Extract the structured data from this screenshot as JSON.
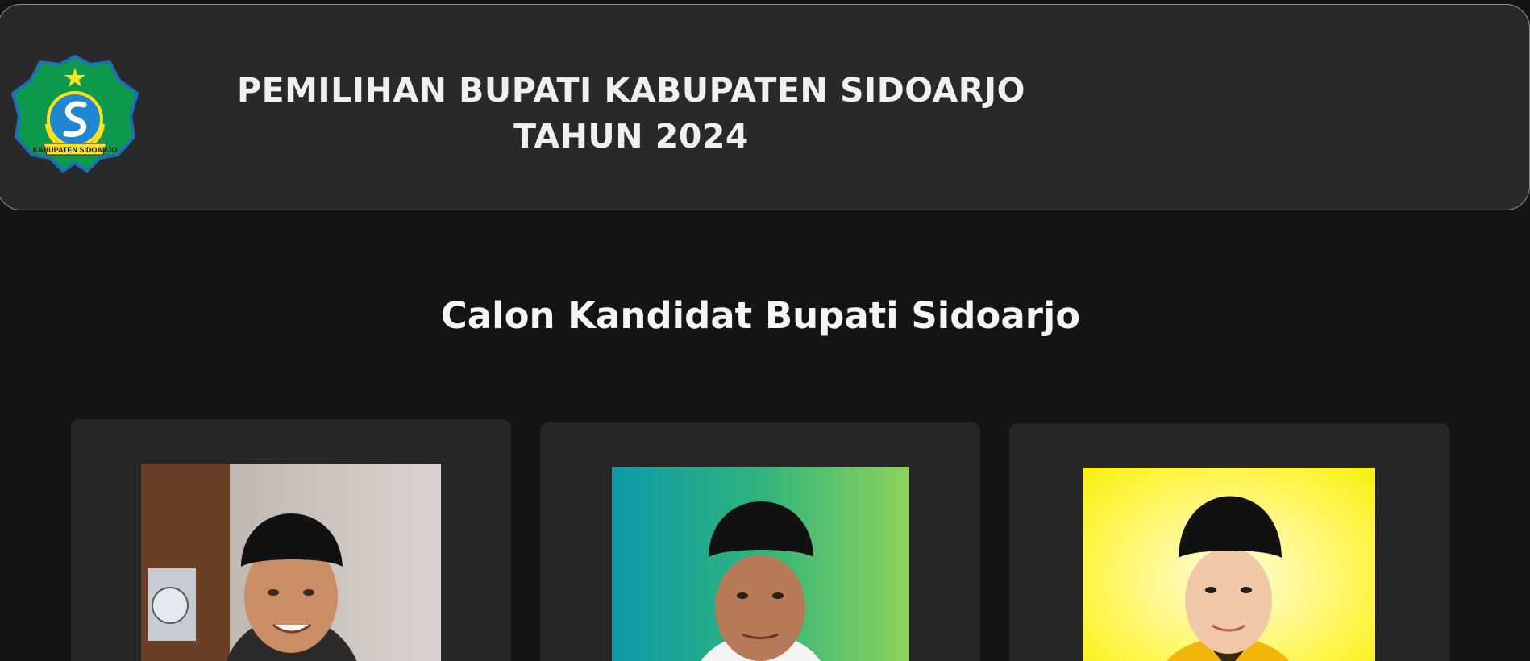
{
  "header": {
    "logo_label": "KABUPATEN SIDOARJO",
    "title_line1": "PEMILIHAN BUPATI KABUPATEN SIDOARJO",
    "title_line2": "TAHUN 2024"
  },
  "main": {
    "section_title": "Calon Kandidat Bupati Sidoarjo"
  },
  "colors": {
    "page_bg": "#141414",
    "header_bg": "#292929",
    "card_bg": "#262626",
    "text": "#f2f2f2"
  }
}
